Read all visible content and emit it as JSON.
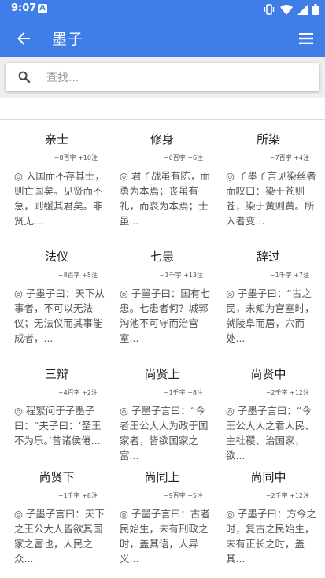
{
  "status": {
    "time": "9:07",
    "notification": "A"
  },
  "app_bar": {
    "title": "墨子"
  },
  "search": {
    "placeholder": "查找..."
  },
  "chapters": [
    {
      "title": "亲士",
      "meta": "~8百字 +10注",
      "excerpt": "◎ 入国而不存其士，则亡国矣。见贤而不急，则缓其君矣。非贤无..."
    },
    {
      "title": "修身",
      "meta": "~6百字 +6注",
      "excerpt": "◎ 君子战虽有陈，而勇为本焉；丧虽有礼，而哀为本焉；士虽..."
    },
    {
      "title": "所染",
      "meta": "~7百字 +4注",
      "excerpt": "◎ 子墨子言见染丝者而叹曰：染于苍则苍，染于黄则黄。所入者变..."
    },
    {
      "title": "法仪",
      "meta": "~8百字 +5注",
      "excerpt": "◎ 子墨子曰：天下从事者，不可以无法仪；无法仪而其事能成者，..."
    },
    {
      "title": "七患",
      "meta": "~1千字 +13注",
      "excerpt": "◎ 子墨子曰：国有七患。七患者何？城郭沟池不可守而治宫室..."
    },
    {
      "title": "辞过",
      "meta": "~1千字 +7注",
      "excerpt": "◎ 子墨子曰：“古之民，未知为宫室时，就陵阜而居，穴而处..."
    },
    {
      "title": "三辩",
      "meta": "~4百字 +2注",
      "excerpt": "◎ 程繁问于子墨子曰：“夫子曰：‘圣王不为乐。’昔诸侯倦..."
    },
    {
      "title": "尚贤上",
      "meta": "~1千字 +8注",
      "excerpt": "◎ 子墨子言曰：“今者王公大人为政于国家者，皆欲国家之富..."
    },
    {
      "title": "尚贤中",
      "meta": "~2千字 +12注",
      "excerpt": "◎ 子墨子言曰：“今王公大人之君人民、主社稷、治国家，欲..."
    },
    {
      "title": "尚贤下",
      "meta": "~1千字 +8注",
      "excerpt": "◎ 子墨子言曰：天下之王公大人皆欲其国家之富也，人民之众..."
    },
    {
      "title": "尚同上",
      "meta": "~9百字 +5注",
      "excerpt": "◎ 子墨子言曰：古者民始生，未有刑政之时，盖其语，人异义..."
    },
    {
      "title": "尚同中",
      "meta": "~2千字 +12注",
      "excerpt": "◎ 子墨子曰：方今之时，复古之民始生，未有正长之时，盖其..."
    }
  ]
}
